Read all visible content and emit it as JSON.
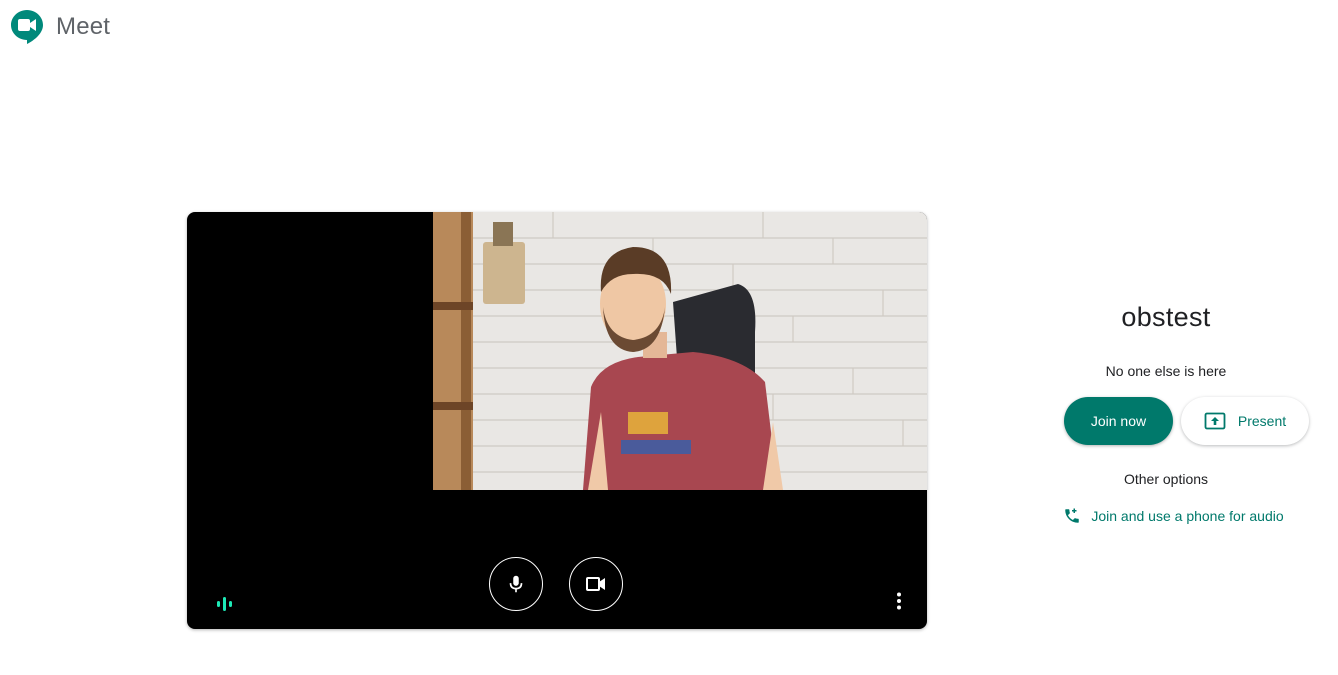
{
  "app": {
    "title": "Meet",
    "logo_icon": "google-meet-logo"
  },
  "preview": {
    "controls": {
      "microphone_icon": "microphone-icon",
      "camera_icon": "video-camera-icon",
      "more_icon": "more-vert-icon",
      "audio_indicator_icon": "audio-level-icon"
    },
    "camera_on": true,
    "microphone_on": true
  },
  "meeting": {
    "name": "obstest",
    "status": "No one else is here",
    "join_label": "Join now",
    "present_label": "Present",
    "present_icon": "present-screen-icon",
    "other_options_label": "Other options",
    "phone_label": "Join and use a phone for audio",
    "phone_icon": "phone-add-icon"
  },
  "colors": {
    "accent": "#00796b",
    "audio_indicator": "#1de9b6"
  }
}
